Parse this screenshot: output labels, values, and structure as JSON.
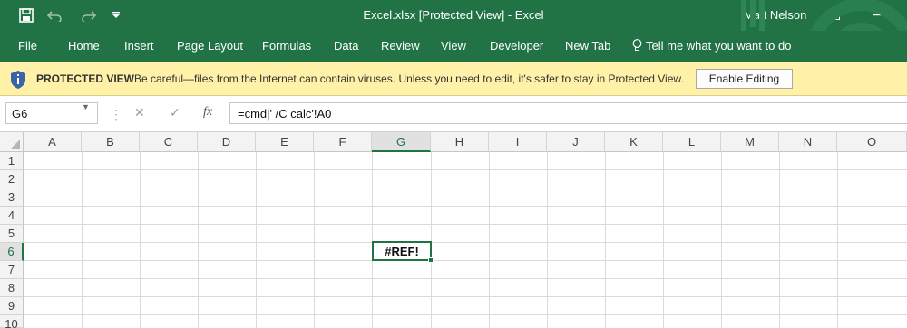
{
  "titlebar": {
    "title": "Excel.xlsx  [Protected View]  -  Excel",
    "user": "Matt Nelson",
    "qat": [
      "save-icon",
      "undo-icon",
      "redo-icon",
      "customize-qat-icon"
    ],
    "window_controls": [
      "ribbon-display-options-icon",
      "minimize-icon"
    ]
  },
  "ribbon": {
    "tabs": [
      "File",
      "Home",
      "Insert",
      "Page Layout",
      "Formulas",
      "Data",
      "Review",
      "View",
      "Developer",
      "New Tab"
    ],
    "tell_me": "Tell me what you want to do"
  },
  "protected_view": {
    "title": "PROTECTED VIEW",
    "message": "Be careful—files from the Internet can contain viruses. Unless you need to edit, it's safer to stay in Protected View.",
    "button": "Enable Editing"
  },
  "formula_bar": {
    "name_box": "G6",
    "fx_label": "fx",
    "formula": "=cmd|' /C calc'!A0"
  },
  "grid": {
    "columns": [
      "A",
      "B",
      "C",
      "D",
      "E",
      "F",
      "G",
      "H",
      "I",
      "J",
      "K",
      "L",
      "M",
      "N",
      "O"
    ],
    "rows": [
      "1",
      "2",
      "3",
      "4",
      "5",
      "6",
      "7",
      "8",
      "9",
      "10"
    ],
    "selected_column": "G",
    "selected_row": "6",
    "active_cell_value": "#REF!"
  },
  "colors": {
    "excel_green": "#217346",
    "protected_view_yellow": "#fff2a8"
  }
}
